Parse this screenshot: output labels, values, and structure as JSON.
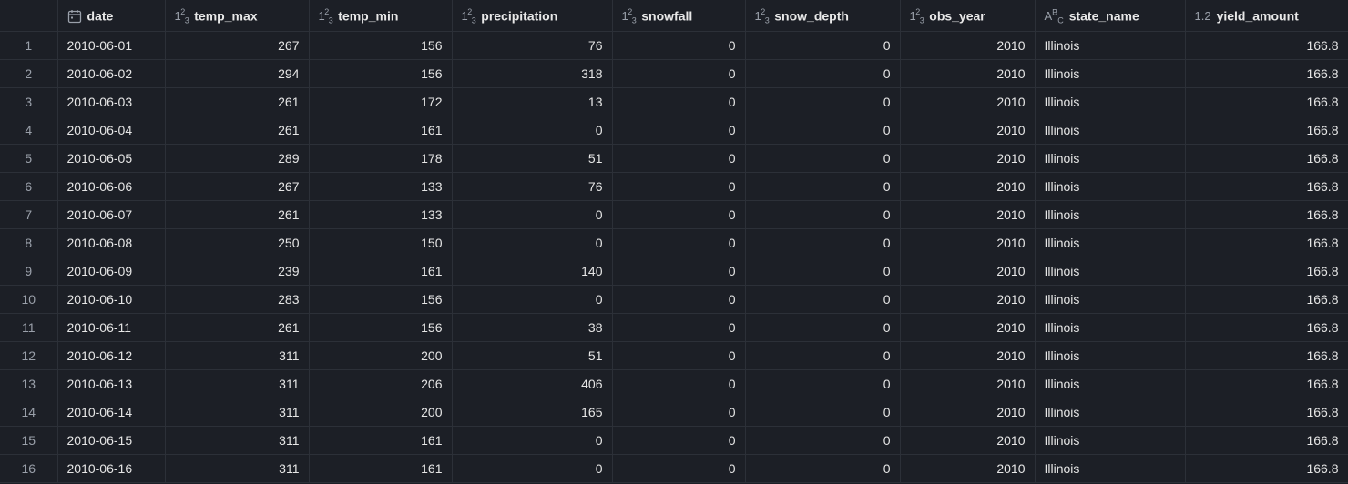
{
  "columns": [
    {
      "key": "date",
      "label": "date",
      "type": "date"
    },
    {
      "key": "temp_max",
      "label": "temp_max",
      "type": "integer"
    },
    {
      "key": "temp_min",
      "label": "temp_min",
      "type": "integer"
    },
    {
      "key": "precipitation",
      "label": "precipitation",
      "type": "integer"
    },
    {
      "key": "snowfall",
      "label": "snowfall",
      "type": "integer"
    },
    {
      "key": "snow_depth",
      "label": "snow_depth",
      "type": "integer"
    },
    {
      "key": "obs_year",
      "label": "obs_year",
      "type": "integer"
    },
    {
      "key": "state_name",
      "label": "state_name",
      "type": "text"
    },
    {
      "key": "yield_amount",
      "label": "yield_amount",
      "type": "decimal"
    }
  ],
  "type_icons": {
    "date": "calendar-icon",
    "integer": "1²₃",
    "text": "Aᴮc",
    "decimal": "1.2"
  },
  "rows": [
    {
      "index": "1",
      "date": "2010-06-01",
      "temp_max": "267",
      "temp_min": "156",
      "precipitation": "76",
      "snowfall": "0",
      "snow_depth": "0",
      "obs_year": "2010",
      "state_name": "Illinois",
      "yield_amount": "166.8"
    },
    {
      "index": "2",
      "date": "2010-06-02",
      "temp_max": "294",
      "temp_min": "156",
      "precipitation": "318",
      "snowfall": "0",
      "snow_depth": "0",
      "obs_year": "2010",
      "state_name": "Illinois",
      "yield_amount": "166.8"
    },
    {
      "index": "3",
      "date": "2010-06-03",
      "temp_max": "261",
      "temp_min": "172",
      "precipitation": "13",
      "snowfall": "0",
      "snow_depth": "0",
      "obs_year": "2010",
      "state_name": "Illinois",
      "yield_amount": "166.8"
    },
    {
      "index": "4",
      "date": "2010-06-04",
      "temp_max": "261",
      "temp_min": "161",
      "precipitation": "0",
      "snowfall": "0",
      "snow_depth": "0",
      "obs_year": "2010",
      "state_name": "Illinois",
      "yield_amount": "166.8"
    },
    {
      "index": "5",
      "date": "2010-06-05",
      "temp_max": "289",
      "temp_min": "178",
      "precipitation": "51",
      "snowfall": "0",
      "snow_depth": "0",
      "obs_year": "2010",
      "state_name": "Illinois",
      "yield_amount": "166.8"
    },
    {
      "index": "6",
      "date": "2010-06-06",
      "temp_max": "267",
      "temp_min": "133",
      "precipitation": "76",
      "snowfall": "0",
      "snow_depth": "0",
      "obs_year": "2010",
      "state_name": "Illinois",
      "yield_amount": "166.8"
    },
    {
      "index": "7",
      "date": "2010-06-07",
      "temp_max": "261",
      "temp_min": "133",
      "precipitation": "0",
      "snowfall": "0",
      "snow_depth": "0",
      "obs_year": "2010",
      "state_name": "Illinois",
      "yield_amount": "166.8"
    },
    {
      "index": "8",
      "date": "2010-06-08",
      "temp_max": "250",
      "temp_min": "150",
      "precipitation": "0",
      "snowfall": "0",
      "snow_depth": "0",
      "obs_year": "2010",
      "state_name": "Illinois",
      "yield_amount": "166.8"
    },
    {
      "index": "9",
      "date": "2010-06-09",
      "temp_max": "239",
      "temp_min": "161",
      "precipitation": "140",
      "snowfall": "0",
      "snow_depth": "0",
      "obs_year": "2010",
      "state_name": "Illinois",
      "yield_amount": "166.8"
    },
    {
      "index": "10",
      "date": "2010-06-10",
      "temp_max": "283",
      "temp_min": "156",
      "precipitation": "0",
      "snowfall": "0",
      "snow_depth": "0",
      "obs_year": "2010",
      "state_name": "Illinois",
      "yield_amount": "166.8"
    },
    {
      "index": "11",
      "date": "2010-06-11",
      "temp_max": "261",
      "temp_min": "156",
      "precipitation": "38",
      "snowfall": "0",
      "snow_depth": "0",
      "obs_year": "2010",
      "state_name": "Illinois",
      "yield_amount": "166.8"
    },
    {
      "index": "12",
      "date": "2010-06-12",
      "temp_max": "311",
      "temp_min": "200",
      "precipitation": "51",
      "snowfall": "0",
      "snow_depth": "0",
      "obs_year": "2010",
      "state_name": "Illinois",
      "yield_amount": "166.8"
    },
    {
      "index": "13",
      "date": "2010-06-13",
      "temp_max": "311",
      "temp_min": "206",
      "precipitation": "406",
      "snowfall": "0",
      "snow_depth": "0",
      "obs_year": "2010",
      "state_name": "Illinois",
      "yield_amount": "166.8"
    },
    {
      "index": "14",
      "date": "2010-06-14",
      "temp_max": "311",
      "temp_min": "200",
      "precipitation": "165",
      "snowfall": "0",
      "snow_depth": "0",
      "obs_year": "2010",
      "state_name": "Illinois",
      "yield_amount": "166.8"
    },
    {
      "index": "15",
      "date": "2010-06-15",
      "temp_max": "311",
      "temp_min": "161",
      "precipitation": "0",
      "snowfall": "0",
      "snow_depth": "0",
      "obs_year": "2010",
      "state_name": "Illinois",
      "yield_amount": "166.8"
    },
    {
      "index": "16",
      "date": "2010-06-16",
      "temp_max": "311",
      "temp_min": "161",
      "precipitation": "0",
      "snowfall": "0",
      "snow_depth": "0",
      "obs_year": "2010",
      "state_name": "Illinois",
      "yield_amount": "166.8"
    }
  ]
}
